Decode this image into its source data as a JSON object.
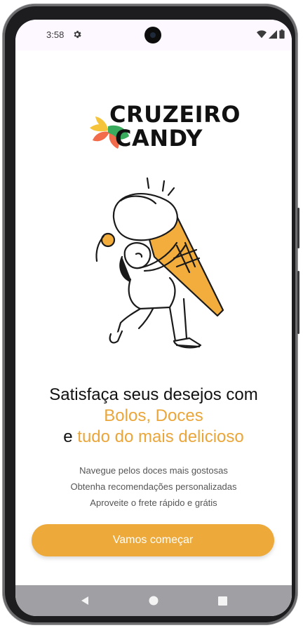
{
  "status_bar": {
    "time": "3:58",
    "icons": [
      "gear-icon",
      "wifi-icon",
      "signal-icon",
      "battery-icon"
    ]
  },
  "logo": {
    "line1": "CRUZEIRO",
    "line2": "CANDY",
    "petal_colors": [
      "#f5c43a",
      "#f26b4b",
      "#3aaa5c"
    ]
  },
  "headline": {
    "line1": "Satisfaça seus desejos com",
    "line2": "Bolos, Doces",
    "line3_prefix": "e",
    "line3_accent": "tudo do mais delicioso"
  },
  "features": [
    "Navegue pelos doces mais gostosas",
    "Obtenha recomendações personalizadas",
    "Aproveite o frete rápido e grátis"
  ],
  "cta": {
    "label": "Vamos começar"
  },
  "nav_bar": {
    "buttons": [
      "back-icon",
      "home-icon",
      "recents-icon"
    ]
  },
  "colors": {
    "accent": "#eda93a",
    "text": "#111111",
    "muted": "#555555"
  }
}
